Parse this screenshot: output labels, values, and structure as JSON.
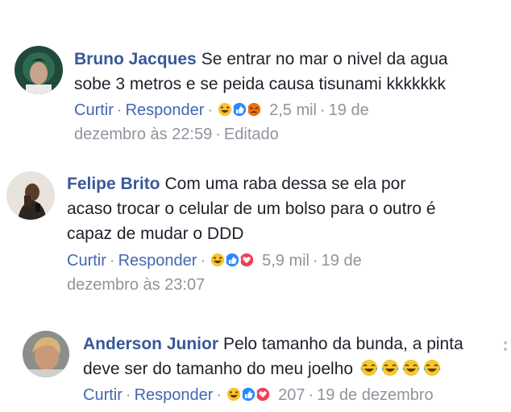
{
  "comments": [
    {
      "author": "Bruno Jacques",
      "text_line1": "Se entrar no mar o nivel da agua",
      "text_line2": "sobe 3 metros e se peida causa tisunami kkkkkkk",
      "like": "Curtir",
      "reply": "Responder",
      "reaction_count": "2,5 mil",
      "time_line1": "19 de",
      "time_line2": "dezembro às 22:59",
      "edited": "Editado",
      "reactions": [
        "haha",
        "like",
        "angry"
      ]
    },
    {
      "author": "Felipe Brito",
      "text_line1": "Com uma raba dessa se ela por",
      "text_line2": "acaso trocar o celular de um bolso para o outro é",
      "text_line3": "capaz de mudar o DDD",
      "like": "Curtir",
      "reply": "Responder",
      "reaction_count": "5,9 mil",
      "time_line1": "19 de",
      "time_line2": "dezembro às 23:07",
      "reactions": [
        "haha",
        "like",
        "love"
      ]
    },
    {
      "author": "Anderson Junior",
      "text_line1": "Pelo tamanho da bunda, a pinta",
      "text_line2": "deve ser do tamanho do meu joelho",
      "like": "Curtir",
      "reply": "Responder",
      "reaction_count": "207",
      "time_line1": "19 de dezembro",
      "reactions": [
        "haha",
        "like",
        "love"
      ],
      "inline_emoji": "tears-of-joy"
    }
  ],
  "colors": {
    "author": "#385898",
    "link": "#4267b2",
    "meta": "#90949c",
    "text": "#1d2129"
  }
}
